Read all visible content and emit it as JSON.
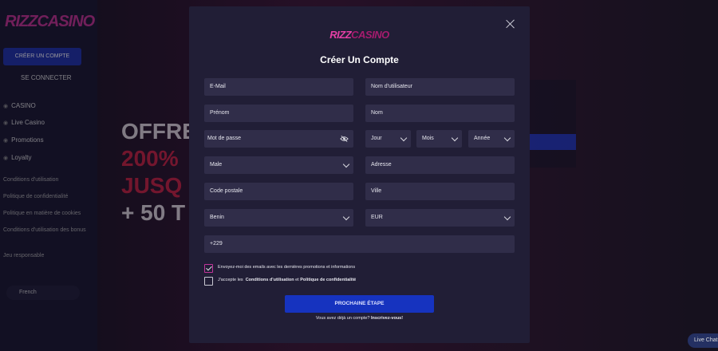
{
  "background": {
    "logo_part1": "RIZZ",
    "logo_part2": "CASINO",
    "signup_label": "CRÉER UN COMPTE",
    "login_label": "SE CONNECTER",
    "nav": [
      "CASINO",
      "Live Casino",
      "Promotions",
      "Loyalty"
    ],
    "links": [
      "Conditions d'utilisation",
      "Politique de confidentialité",
      "Politique en matière de cookies",
      "Conditions d'utilisation des bonus",
      "Jeu responsable"
    ],
    "language": "French",
    "hero_lines": [
      "OFFRE",
      "200%",
      "JUSQ",
      "+ 50 T"
    ],
    "live_chat": "Live Chat"
  },
  "modal": {
    "logo_part1": "RIZZ",
    "logo_part2": "CASINO",
    "title": "Créer Un Compte",
    "fields": {
      "email_placeholder": "E-Mail",
      "username_placeholder": "Nom d'utilisateur",
      "firstname_placeholder": "Prénom",
      "lastname_placeholder": "Nom",
      "password_placeholder": "Mot de passe",
      "day": "Jour",
      "month": "Mois",
      "year": "Année",
      "gender": "Male",
      "address_placeholder": "Adresse",
      "postal_placeholder": "Code postale",
      "city_placeholder": "Ville",
      "country": "Benin",
      "currency": "EUR",
      "phone": "+229"
    },
    "consent_emails": "Envoyez-moi des emails avec les dernières promotions et informations",
    "accept_prefix": "J'accepte les",
    "accept_terms": "Conditions d'utilisation",
    "accept_and": "et",
    "accept_privacy": "Politique de confidentialité",
    "submit_label": "PROCHAINE ÉTAPE",
    "have_account": "Vous avez déjà un compte?",
    "login_link": "Inscrivez-vous!"
  }
}
